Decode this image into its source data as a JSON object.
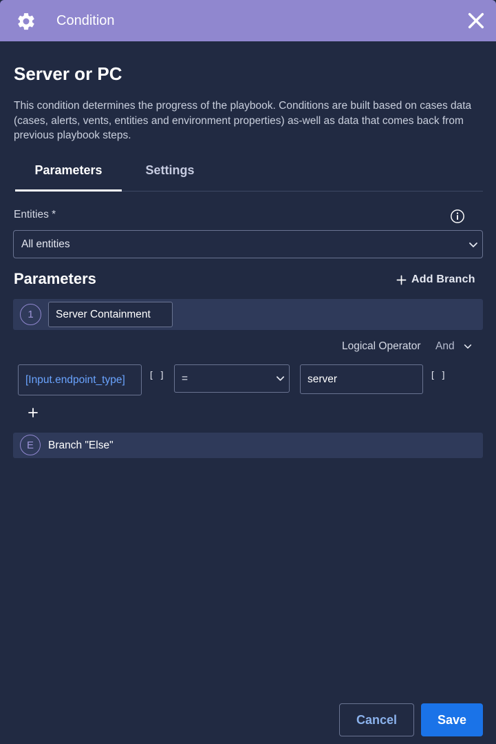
{
  "header": {
    "title": "Condition",
    "icon": "gear-icon",
    "close_icon": "close-icon",
    "background": "#9087cf"
  },
  "page": {
    "title": "Server or PC",
    "description": "This condition determines the progress of the playbook. Conditions are built based on cases data (cases, alerts, vents, entities and environment properties) as-well as data that comes back from previous playbook steps."
  },
  "tabs": [
    {
      "label": "Parameters",
      "active": true
    },
    {
      "label": "Settings",
      "active": false
    }
  ],
  "entities": {
    "label": "Entities *",
    "value": "All entities",
    "info_icon": "info-icon"
  },
  "parameters": {
    "title": "Parameters",
    "add_branch_label": "Add Branch",
    "branches": [
      {
        "badge": "1",
        "name": "Server Containment"
      },
      {
        "badge": "E",
        "name": "Branch \"Else\""
      }
    ],
    "logical_operator": {
      "label": "Logical Operator",
      "value": "And"
    },
    "condition": {
      "left": "[Input.endpoint_type]",
      "operator": "=",
      "right": "server",
      "bracket_symbol": "[ ]"
    }
  },
  "footer": {
    "cancel_label": "Cancel",
    "save_label": "Save",
    "accent": "#1a73e8"
  }
}
